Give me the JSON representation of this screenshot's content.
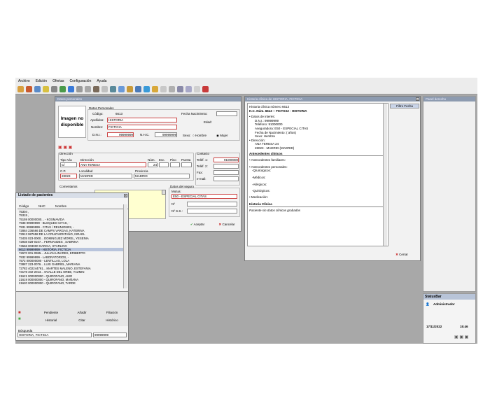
{
  "menu": [
    "Archivo",
    "Edición",
    "Ofertas",
    "Configuración",
    "Ayuda"
  ],
  "patient_form": {
    "title": "Datos personales",
    "photo_line1": "Imagen no",
    "photo_line2": "disponible",
    "datos_personales": "Datos Personales",
    "codigo_label": "Código:",
    "codigo": "6613",
    "fecha_nac_label": "Fecha Nacimiento:",
    "apellidos_label": "Apellidos:",
    "apellidos": "HISTORIA",
    "edad_label": "Edad:",
    "nombre_label": "Nombre:",
    "nombre": "FICTICIA",
    "dni_label": "D.N.I.:",
    "dni": "99999999",
    "nac_label": "N.H.C.",
    "nac": "99999999",
    "sexo_label": "Sexo:",
    "hombre": "Hombre",
    "mujer": "Mujer",
    "direccion_title": "Dirección",
    "tipo_via_label": "Tipo Vía",
    "tipo_via": "C/",
    "direccion_label": "Dirección",
    "direccion": "ANA TERESA",
    "num_label": "Núm.",
    "num": "24",
    "esc_label": "Esc.",
    "piso_label": "Piso",
    "puerta_label": "Puerta",
    "cp_label": "C.P.",
    "cp": "28023",
    "localidad_label": "Localidad",
    "localidad": "MADRID",
    "provincia_label": "Provincia",
    "provincia": "MADRID",
    "contacto_title": "Contacto",
    "telf1_label": "Teléf. 1:",
    "telf1": "91000000",
    "telf2_label": "Teléf. 2:",
    "fax_label": "Fax:",
    "email_label": "e-mail:",
    "comentarios_title": "Comentarios",
    "seguro_title": "Datos del seguro",
    "mutua_label": "Mutua:",
    "mutua": "E50 - ESPECIAL CITAS",
    "n_label": "Nº",
    "nss_label": "Nº S.S.:",
    "aceptar": "Aceptar",
    "cancelar": "Cancelar"
  },
  "historia": {
    "title": "Historia clínica de HISTORIA, FICTICIA",
    "number_line": "Historia clínica número 6613",
    "header": "H.C. Núm. 6613 -- FICTICIA - HISTORIA",
    "side_button": "Filtro Fecha",
    "lines": [
      "• Datos de interés:",
      "D.N.I.: 99999999",
      "Teléfono: 91000000",
      "Aseguradora: E50 - ESPECIAL CITAS",
      "Fecha de Nacimiento: ( años)",
      "Sexo: Hembra",
      "• Dirección:",
      "ANA TERESA 24",
      "28023 - MADRID (MADRID)"
    ],
    "antecedentes_clinicos": "Antecedentes clínicos",
    "familiares": "• Antecedentes familiares:",
    "personales": "• Antecedentes personales:",
    "quirurgicos": "-Q/uirúrgicos:",
    "medicos": "-Médicos:",
    "alergicos": "-Alérgicos:",
    "quirurgicos2": "-Quirúrgicos:",
    "medicacion": "• Medicación:",
    "historia_clinica": "Historia Clínica",
    "sin_datos": "Paciente sin datos clínicos grabados",
    "cerrar": "Cerrar"
  },
  "listado": {
    "title": "Listado de pacientes",
    "col_codigo": "Código",
    "col_nhc": "NHC",
    "col_nombre": "Nombre",
    "rows": [
      "75304              ,",
      "75315              ,",
      "75159 00000000... - KOSMAVIDA",
      "7938    99999999 - BLOQUEO CITAS, -",
      "7931    99999999 - CITAS / REUNIONES, -",
      "72884     236566 DE CAMPS VARGAS, KATERINA",
      "72913     987658 DE LA CRUZ MONTAÑO, ISRAEL",
      "73435  023-0000... DOMINGUEZ MOREL, YESENIA",
      "72938  028-0107... FERNANDES , SABRINA",
      "74566      003000 GARCIA, STARLING",
      "6613    99999999 - HISTORIA, FICTICIA",
      "72670  001-0965... JULIAN LINARES, ERIBERTO",
      "7932    99999999 - LABORATORIOS, -",
      "7572  000000000 - LENTILLAS, LOLA",
      "73887  223-0076... LUIS GABRIEL, MARIANA",
      "72782  402244791... MARTES MALENO, ESTEFANIA",
      "73178  402-2013... OVALLE DEL ORBE, YAZMIN",
      "21621  000000000 - QUIROFANO, AMO",
      "21619  000000000 - QUIROFANO, MAÑANA",
      "21620  000000000 - QUIROFANO, TARDE"
    ],
    "buttons": [
      "Pendiente",
      "Añadir",
      "Filiación",
      "Historial",
      "Citar",
      "Histórico"
    ],
    "busqueda_label": "Búsqueda",
    "busqueda": "HISTORIA, FICTICIA",
    "busqueda2": "99999999"
  },
  "right_panel": {
    "title": "Panel derecho",
    "status_title": "StatusBar",
    "user": "Administrador",
    "date": "17/11/2022",
    "time": "15:46"
  }
}
